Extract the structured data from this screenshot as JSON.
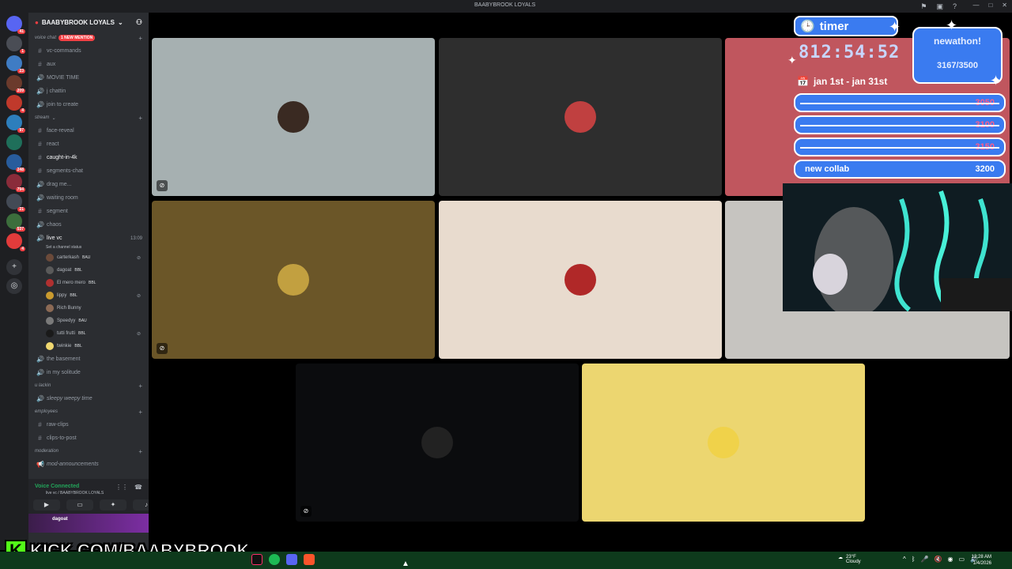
{
  "window": {
    "title": "BAABYBROOK LOYALS"
  },
  "servers": [
    {
      "badge": "41",
      "color": "#5865f2"
    },
    {
      "badge": "1",
      "color": "#4a4d55"
    },
    {
      "badge": "23",
      "color": "#3f7cc4"
    },
    {
      "badge": "209",
      "color": "#6b3a2c"
    },
    {
      "badge": "4",
      "color": "#c0392b"
    },
    {
      "badge": "97",
      "color": "#2d7ebc"
    },
    {
      "badge": "",
      "color": "#1f6f5a"
    },
    {
      "badge": "248",
      "color": "#285c9c"
    },
    {
      "badge": "794",
      "color": "#8a2c3a"
    },
    {
      "badge": "21",
      "color": "#434a55"
    },
    {
      "badge": "537",
      "color": "#3c6e3c"
    },
    {
      "badge": "4",
      "color": "#e23b3b"
    }
  ],
  "sidebar": {
    "guild_name": "BAABYBROOK LOYALS",
    "voice_category": "voice chat",
    "new_mention": "1 NEW MENTION",
    "voice_channels": [
      {
        "icon": "#",
        "name": "vc-commands"
      },
      {
        "icon": "#",
        "name": "aux"
      },
      {
        "icon": "🔊",
        "name": "MOVIE TIME"
      },
      {
        "icon": "🔊",
        "name": "j chattin"
      },
      {
        "icon": "🔊",
        "name": "join to create"
      }
    ],
    "stream_category": "stream",
    "stream_channels": [
      {
        "icon": "#",
        "name": "face-reveal"
      },
      {
        "icon": "#",
        "name": "react"
      },
      {
        "icon": "#",
        "name": "caught-in-4k"
      },
      {
        "icon": "#",
        "name": "segments-chat"
      },
      {
        "icon": "🔊",
        "name": "drag me..."
      },
      {
        "icon": "🔊",
        "name": "waiting room"
      },
      {
        "icon": "#",
        "name": "segment"
      },
      {
        "icon": "🔊",
        "name": "chaos"
      }
    ],
    "live_vc": {
      "name": "live vc",
      "time": "13:09",
      "status": "Set a channel status"
    },
    "members": [
      {
        "name": "carterkash",
        "tag": "BAU",
        "color": "#6b4a3a"
      },
      {
        "name": "dagoat",
        "tag": "BBL",
        "color": "#5a5a5a"
      },
      {
        "name": "El mero mero",
        "tag": "BBL",
        "color": "#b03030"
      },
      {
        "name": "lippy",
        "tag": "BBL",
        "color": "#c99a2e"
      },
      {
        "name": "Rich Bunny",
        "tag": "",
        "color": "#8c6a55"
      },
      {
        "name": "Speedyy",
        "tag": "BAU",
        "color": "#7a7a7a"
      },
      {
        "name": "tutti frutti",
        "tag": "BBL",
        "color": "#1a1a1a"
      },
      {
        "name": "twinkie",
        "tag": "BBL",
        "color": "#f0d870"
      }
    ],
    "after_channels": [
      {
        "icon": "🔊",
        "name": "the basement"
      },
      {
        "icon": "🔊",
        "name": "in my solitude"
      }
    ],
    "lackin_category": "u lackin",
    "lackin_channel": "sleepy weepy time",
    "employees_category": "employees",
    "employee_channels": [
      {
        "icon": "#",
        "name": "raw-clips"
      },
      {
        "icon": "#",
        "name": "clips-to-post"
      }
    ],
    "moderation_category": "moderation",
    "mod_channel": "mod-announcements"
  },
  "voice_panel": {
    "status": "Voice Connected",
    "channel": "live vc / BAABYBROOK LOYALS",
    "user": "dagoat"
  },
  "tiles": [
    {
      "bg": "#a6b0b1",
      "av": "#3a2a22"
    },
    {
      "bg": "#2e2e2e",
      "av": "#c04040"
    },
    {
      "bg": "#c0565e",
      "av": ""
    },
    {
      "bg": "#6b5628",
      "av": "#c2a040"
    },
    {
      "bg": "#e8dbce",
      "av": "#b02828"
    },
    {
      "bg": "#c6c4c0",
      "av": ""
    },
    {
      "bg": "#0b0c0e",
      "av": "#222"
    },
    {
      "bg": "#ecd670",
      "av": "#f0d24a"
    }
  ],
  "overlay": {
    "timer_label": "timer",
    "timer_value": "812:54:52",
    "subathon_title": "newathon!",
    "subathon_count": "3167/3500",
    "date_range": "jan 1st - jan 31st",
    "goals": [
      {
        "label": "",
        "value": "3050",
        "done": true
      },
      {
        "label": "",
        "value": "3100",
        "done": true
      },
      {
        "label": "",
        "value": "3150",
        "done": true
      },
      {
        "label": "new collab",
        "value": "3200",
        "done": false
      }
    ]
  },
  "kick_banner": "KICK.COM/BAABYBROOK",
  "taskbar": {
    "weather_temp": "23°F",
    "weather_desc": "Cloudy",
    "time": "12:28 AM",
    "date": "1/4/2026"
  }
}
